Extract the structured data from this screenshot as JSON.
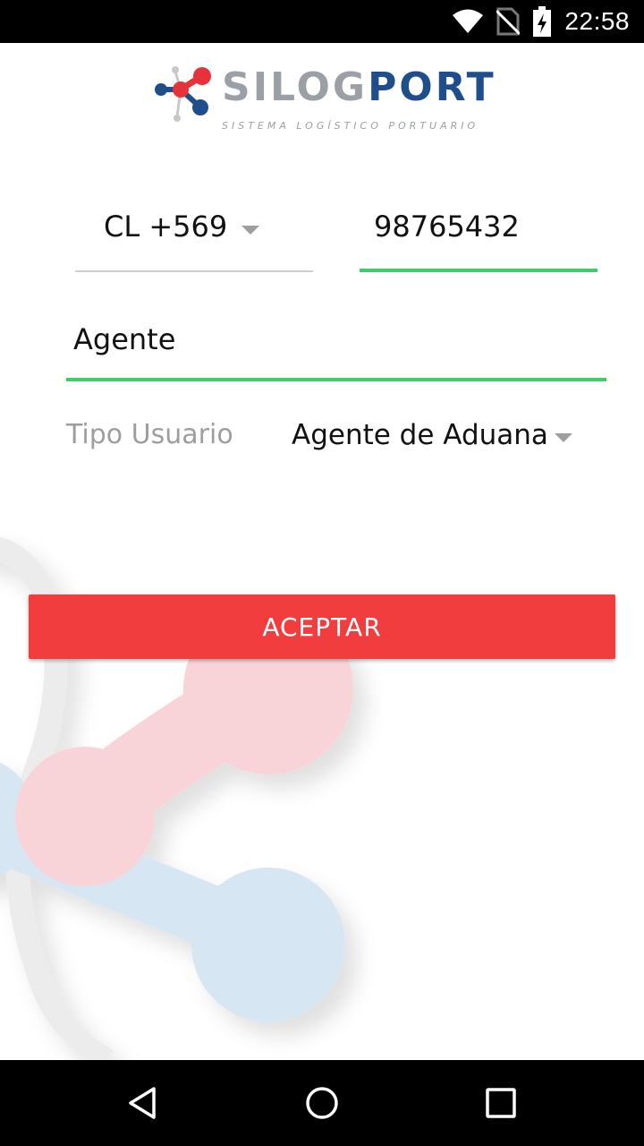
{
  "status_bar": {
    "time": "22:58",
    "icons": [
      "wifi-icon",
      "no-sim-icon",
      "battery-charging-icon"
    ]
  },
  "logo": {
    "name_part1": "SILOG",
    "name_part2": "PORT",
    "tagline": "SISTEMA LOGÍSTICO PORTUARIO",
    "colors": {
      "gray": "#9aa0a6",
      "blue": "#1f4e8c",
      "red": "#e8323a"
    }
  },
  "form": {
    "country_code": "CL +569",
    "phone": "98765432",
    "name": "Agente",
    "user_type_label": "Tipo Usuario",
    "user_type_value": "Agente de Aduana"
  },
  "accept_button": {
    "label": "ACEPTAR",
    "color": "#f23d3f"
  },
  "accent_color": "#3ecf64",
  "nav_bar": {
    "icons": [
      "back-icon",
      "home-icon",
      "recents-icon"
    ]
  }
}
